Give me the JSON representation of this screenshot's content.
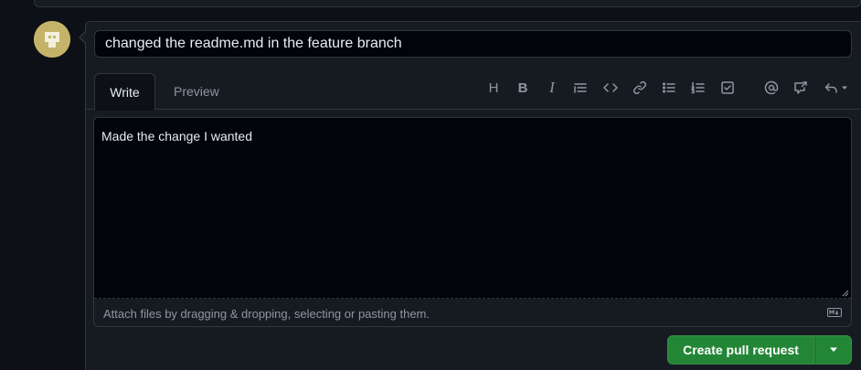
{
  "form": {
    "title_value": "changed the readme.md in the feature branch",
    "tabs": [
      {
        "label": "Write",
        "active": true
      },
      {
        "label": "Preview",
        "active": false
      }
    ],
    "body_value": "Made the change I wanted",
    "attach_hint": "Attach files by dragging & dropping, selecting or pasting them.",
    "markdown_icon": "markdown-icon"
  },
  "toolbar": {
    "items": [
      {
        "icon": "heading-icon",
        "glyph": "H"
      },
      {
        "icon": "bold-icon",
        "glyph": "B"
      },
      {
        "icon": "italic-icon",
        "glyph": "I"
      },
      {
        "icon": "quote-icon"
      },
      {
        "icon": "code-icon"
      },
      {
        "icon": "link-icon"
      },
      {
        "icon": "unordered-list-icon"
      },
      {
        "icon": "ordered-list-icon"
      },
      {
        "icon": "task-list-icon"
      },
      {
        "icon": "mention-icon"
      },
      {
        "icon": "cross-reference-icon"
      },
      {
        "icon": "saved-replies-icon"
      }
    ]
  },
  "actions": {
    "submit_label": "Create pull request",
    "dropdown_icon": "triangle-down-icon"
  },
  "colors": {
    "background": "#0d1117",
    "panel": "#161b22",
    "border": "#30363d",
    "primary_button": "#238636",
    "muted_text": "#8d96a0",
    "text": "#e6edf3"
  }
}
